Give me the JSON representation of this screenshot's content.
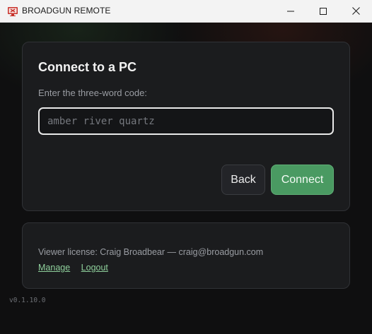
{
  "window": {
    "title": "BROADGUN REMOTE",
    "icon": "monitor-remote-icon",
    "controls": {
      "minimize": "minimize-icon",
      "maximize": "maximize-icon",
      "close": "close-icon"
    }
  },
  "connect": {
    "heading": "Connect to a PC",
    "code_label": "Enter the three-word code:",
    "code_value": "",
    "code_placeholder": "amber river quartz",
    "back_label": "Back",
    "connect_label": "Connect"
  },
  "license": {
    "text": "Viewer license: Craig Broadbear — craig@broadgun.com",
    "manage_label": "Manage",
    "logout_label": "Logout"
  },
  "version": "v0.1.10.0",
  "colors": {
    "accent": "#4a9a62",
    "link": "#8fd09c",
    "card_bg": "#1b1c1e",
    "window_bg": "#0f0f10"
  }
}
